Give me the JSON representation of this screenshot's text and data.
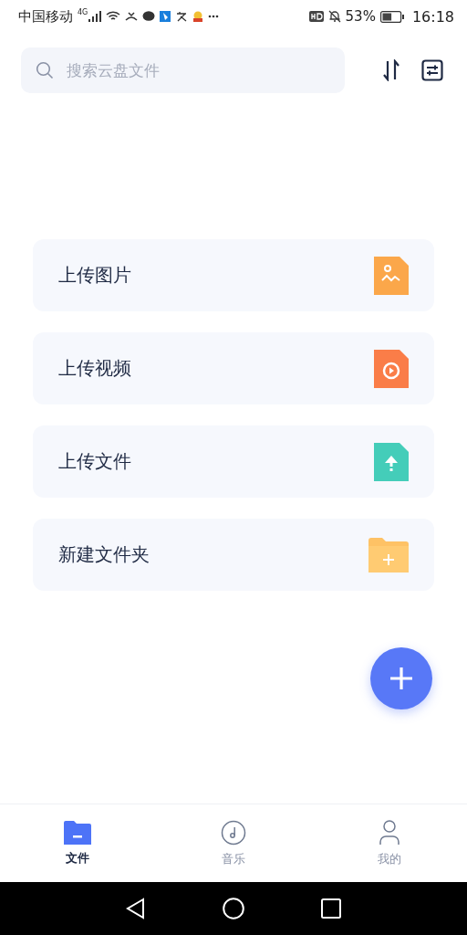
{
  "status_bar": {
    "carrier": "中国移动",
    "network": "4G",
    "battery": "53%",
    "time": "16:18"
  },
  "search": {
    "placeholder": "搜索云盘文件"
  },
  "actions": [
    {
      "kind": "image",
      "label": "上传图片"
    },
    {
      "kind": "video",
      "label": "上传视频"
    },
    {
      "kind": "file",
      "label": "上传文件"
    },
    {
      "kind": "folder",
      "label": "新建文件夹"
    }
  ],
  "tabs": [
    {
      "kind": "files",
      "label": "文件",
      "selected": true
    },
    {
      "kind": "music",
      "label": "音乐",
      "selected": false
    },
    {
      "kind": "me",
      "label": "我的",
      "selected": false
    }
  ]
}
